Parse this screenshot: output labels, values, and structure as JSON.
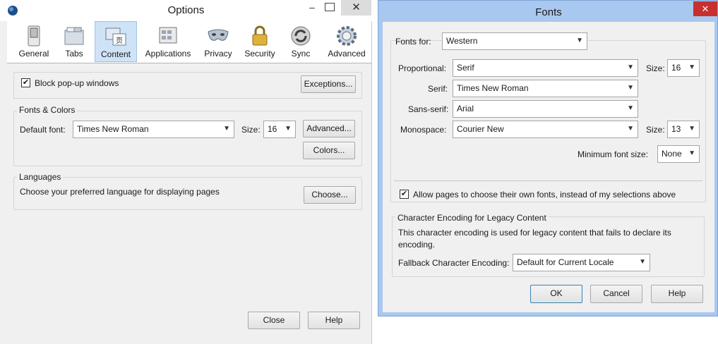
{
  "options": {
    "title": "Options",
    "categories": [
      {
        "label": "General",
        "icon": "switch-icon"
      },
      {
        "label": "Tabs",
        "icon": "folder-tabs-icon"
      },
      {
        "label": "Content",
        "icon": "content-document-icon"
      },
      {
        "label": "Applications",
        "icon": "applications-icon"
      },
      {
        "label": "Privacy",
        "icon": "privacy-mask-icon"
      },
      {
        "label": "Security",
        "icon": "padlock-icon"
      },
      {
        "label": "Sync",
        "icon": "sync-icon"
      },
      {
        "label": "Advanced",
        "icon": "gear-icon"
      }
    ],
    "selected_category": "Content",
    "popup": {
      "label": "Block pop-up windows",
      "checked": true,
      "exceptions": "Exceptions..."
    },
    "fonts_colors": {
      "heading": "Fonts & Colors",
      "default_font_label": "Default font:",
      "default_font": "Times New Roman",
      "size_label": "Size:",
      "size": "16",
      "advanced_button": "Advanced...",
      "colors_button": "Colors..."
    },
    "languages": {
      "heading": "Languages",
      "description": "Choose your preferred language for displaying pages",
      "choose_button": "Choose..."
    },
    "close_button": "Close",
    "help_button": "Help"
  },
  "fonts": {
    "title": "Fonts",
    "fonts_for_label": "Fonts for:",
    "fonts_for": "Western",
    "proportional_label": "Proportional:",
    "proportional": "Serif",
    "size_label": "Size:",
    "proportional_size": "16",
    "serif_label": "Serif:",
    "serif": "Times New Roman",
    "sans_serif_label": "Sans-serif:",
    "sans_serif": "Arial",
    "monospace_label": "Monospace:",
    "monospace": "Courier New",
    "monospace_size": "13",
    "min_font_label": "Minimum font size:",
    "min_font": "None",
    "allow_pages_label": "Allow pages to choose their own fonts, instead of my selections above",
    "allow_pages_checked": true,
    "encoding": {
      "heading": "Character Encoding for Legacy Content",
      "description": "This character encoding is used for legacy content that fails to declare its encoding.",
      "fallback_label": "Fallback Character Encoding:",
      "fallback": "Default for Current Locale"
    },
    "ok_button": "OK",
    "cancel_button": "Cancel",
    "help_button": "Help"
  },
  "colors": {
    "options_bg": "#f0f0f0",
    "fonts_frame": "#a9c8ef",
    "selected_tab": "#cfe3f7",
    "close_red": "#c7302f"
  }
}
